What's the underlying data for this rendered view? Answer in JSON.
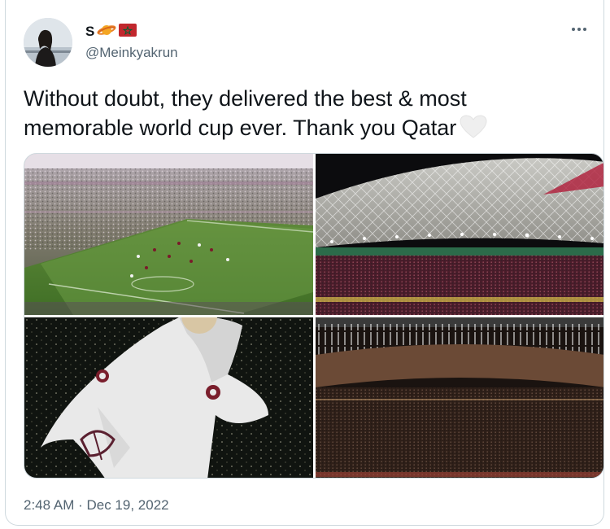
{
  "tweet": {
    "display_name": "S",
    "name_emojis": [
      "planet-emoji",
      "flag-emoji"
    ],
    "handle": "@Meinkyakrun",
    "text": "Without doubt, they delivered the best & most memorable world cup ever. Thank you Qatar",
    "text_emoji": "white-heart-emoji",
    "timestamp": "2:48 AM · Dec 19, 2022"
  },
  "media": {
    "photos": [
      {
        "name": "stadium-pitch-photo"
      },
      {
        "name": "stadium-roof-lights-photo"
      },
      {
        "name": "mascot-laeeb-photo"
      },
      {
        "name": "stadium-fireworks-photo"
      }
    ]
  },
  "colors": {
    "text_primary": "#0f1419",
    "text_secondary": "#536471",
    "border": "#cfd9de"
  }
}
